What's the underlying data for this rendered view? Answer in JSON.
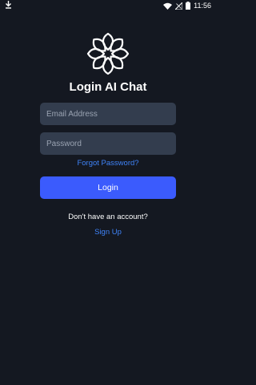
{
  "status_bar": {
    "time": "11:56"
  },
  "app": {
    "title": "Login AI Chat"
  },
  "form": {
    "email_placeholder": "Email Address",
    "email_value": "",
    "password_placeholder": "Password",
    "password_value": "",
    "forgot_label": "Forgot Password?",
    "login_label": "Login"
  },
  "footer": {
    "prompt": "Don't have an account?",
    "signup_label": "Sign Up"
  },
  "colors": {
    "background": "#141821",
    "field_bg": "#333d4e",
    "accent_button": "#3b5bfd",
    "link": "#3f83f8"
  },
  "icons": {
    "status_left": "download-icon",
    "wifi": "wifi-icon",
    "signal": "signal-icon",
    "battery": "battery-icon",
    "logo": "flower-logo-icon"
  }
}
